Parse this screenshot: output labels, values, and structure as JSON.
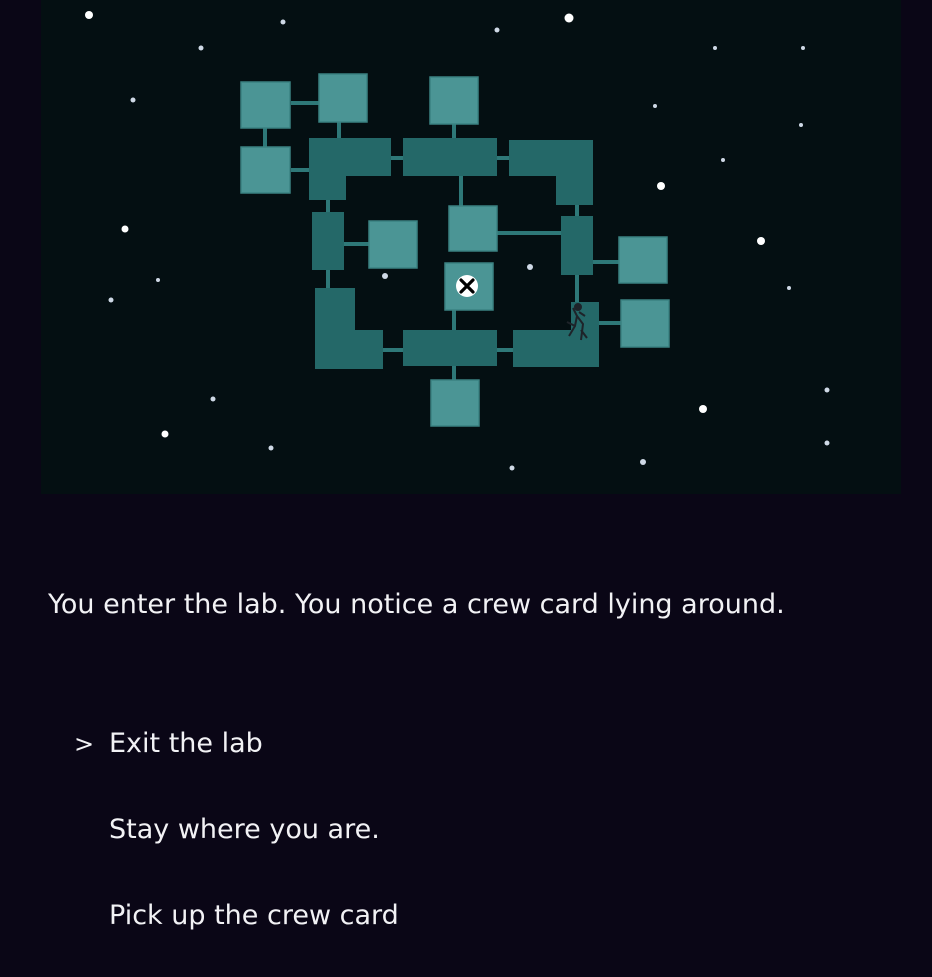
{
  "game": {
    "narrative": "You enter the lab. You notice a crew card lying around.",
    "selection_marker": ">",
    "choices": [
      {
        "label": "Exit the lab",
        "selected": true
      },
      {
        "label": "Stay where you are.",
        "selected": false
      },
      {
        "label": "Pick up the crew card",
        "selected": false
      }
    ]
  },
  "map": {
    "background_color": "#040f12",
    "room_color": "#4b9595",
    "corridor_color": "#246868",
    "player_marker_icon": "close-x-icon",
    "creature_icon": "alien-creature-icon"
  }
}
